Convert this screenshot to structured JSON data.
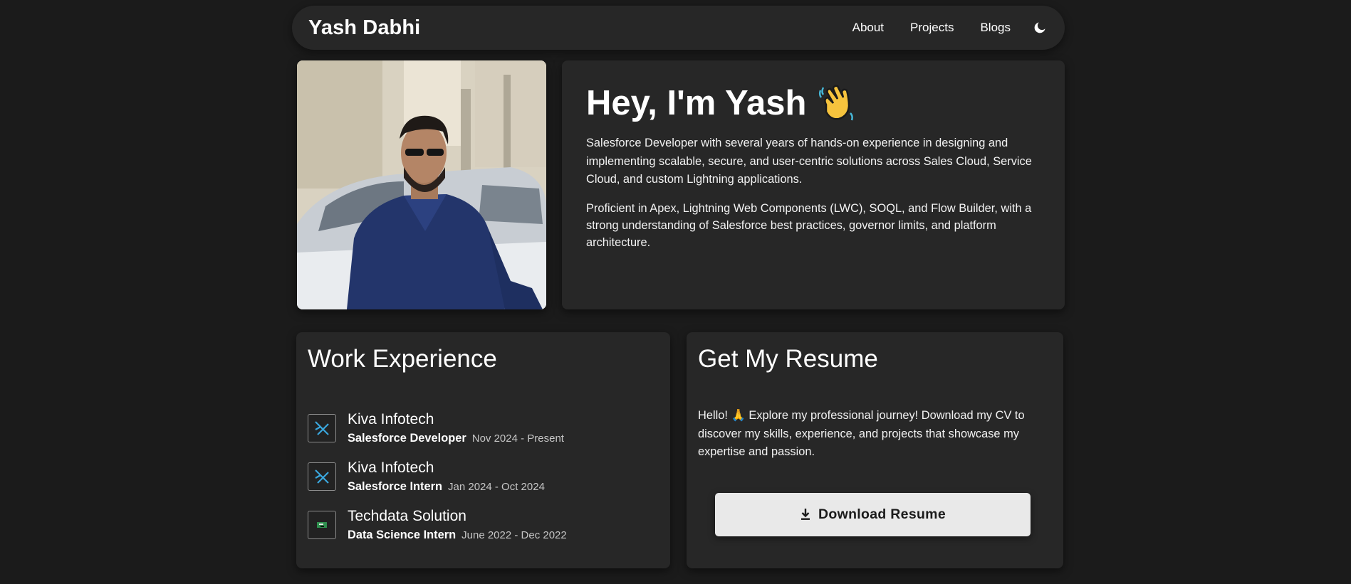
{
  "header": {
    "brand": "Yash Dabhi",
    "nav": [
      "About",
      "Projects",
      "Blogs"
    ],
    "theme_icon": "moon-icon"
  },
  "hero": {
    "photo_alt": "Yash Dabhi",
    "title": "Hey, I'm Yash",
    "title_emoji": "waving-hand-icon",
    "bio": [
      "Salesforce Developer with several years of hands-on experience in designing and implementing scalable, secure, and user-centric solutions across Sales Cloud, Service Cloud, and custom Lightning applications.",
      "Proficient in Apex, Lightning Web Components (LWC), SOQL, and Flow Builder, with a strong understanding of Salesforce best practices, governor limits, and platform architecture."
    ]
  },
  "work": {
    "title": "Work Experience",
    "jobs": [
      {
        "company": "Kiva Infotech",
        "role": "Salesforce Developer",
        "dates": "Nov 2024 - Present",
        "logo": "kiva-infotech-logo-icon"
      },
      {
        "company": "Kiva Infotech",
        "role": "Salesforce Intern",
        "dates": "Jan 2024 - Oct 2024",
        "logo": "kiva-infotech-logo-icon"
      },
      {
        "company": "Techdata Solution",
        "role": "Data Science Intern",
        "dates": "June 2022 - Dec 2022",
        "logo": "techdata-logo-icon"
      }
    ]
  },
  "resume": {
    "title": "Get My Resume",
    "text": "Hello! 🙏 Explore my professional journey! Download my CV to discover my skills, experience, and projects that showcase my expertise and passion.",
    "button": "Download Resume",
    "button_icon": "download-icon"
  },
  "colors": {
    "background": "#1b1b1b",
    "card": "#272727",
    "button_bg": "#e9e9e9",
    "text": "#ffffff",
    "muted": "#c6c6c6"
  }
}
